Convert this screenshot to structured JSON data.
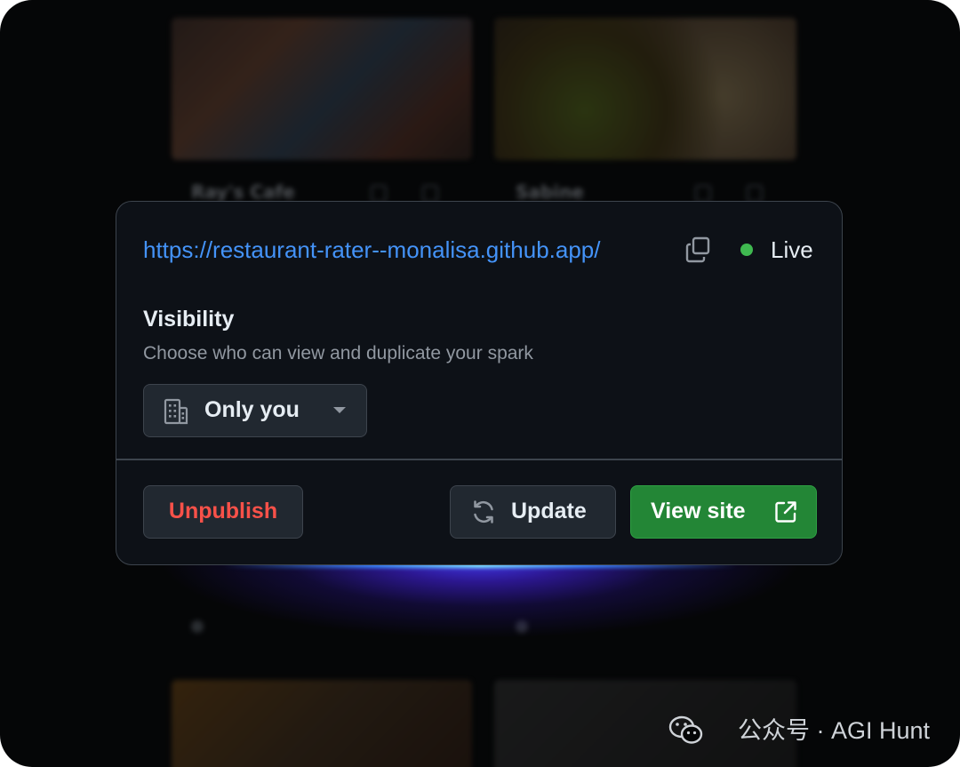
{
  "background": {
    "cards": [
      {
        "title": "Ray's Cafe"
      },
      {
        "title": "Sabine"
      }
    ]
  },
  "publish_dialog": {
    "url": "https://restaurant-rater--monalisa.github.app/",
    "copy_icon": "copy-icon",
    "status": {
      "label": "Live",
      "color": "#3fb950"
    },
    "visibility": {
      "title": "Visibility",
      "description": "Choose who can view and duplicate your spark",
      "selected": "Only you",
      "icon": "building-icon"
    },
    "actions": {
      "unpublish": "Unpublish",
      "update": "Update",
      "view_site": "View site"
    },
    "colors": {
      "link": "#4493f8",
      "danger": "#f85149",
      "primary": "#238636"
    }
  },
  "watermark": {
    "text": "公众号 · AGI Hunt"
  }
}
